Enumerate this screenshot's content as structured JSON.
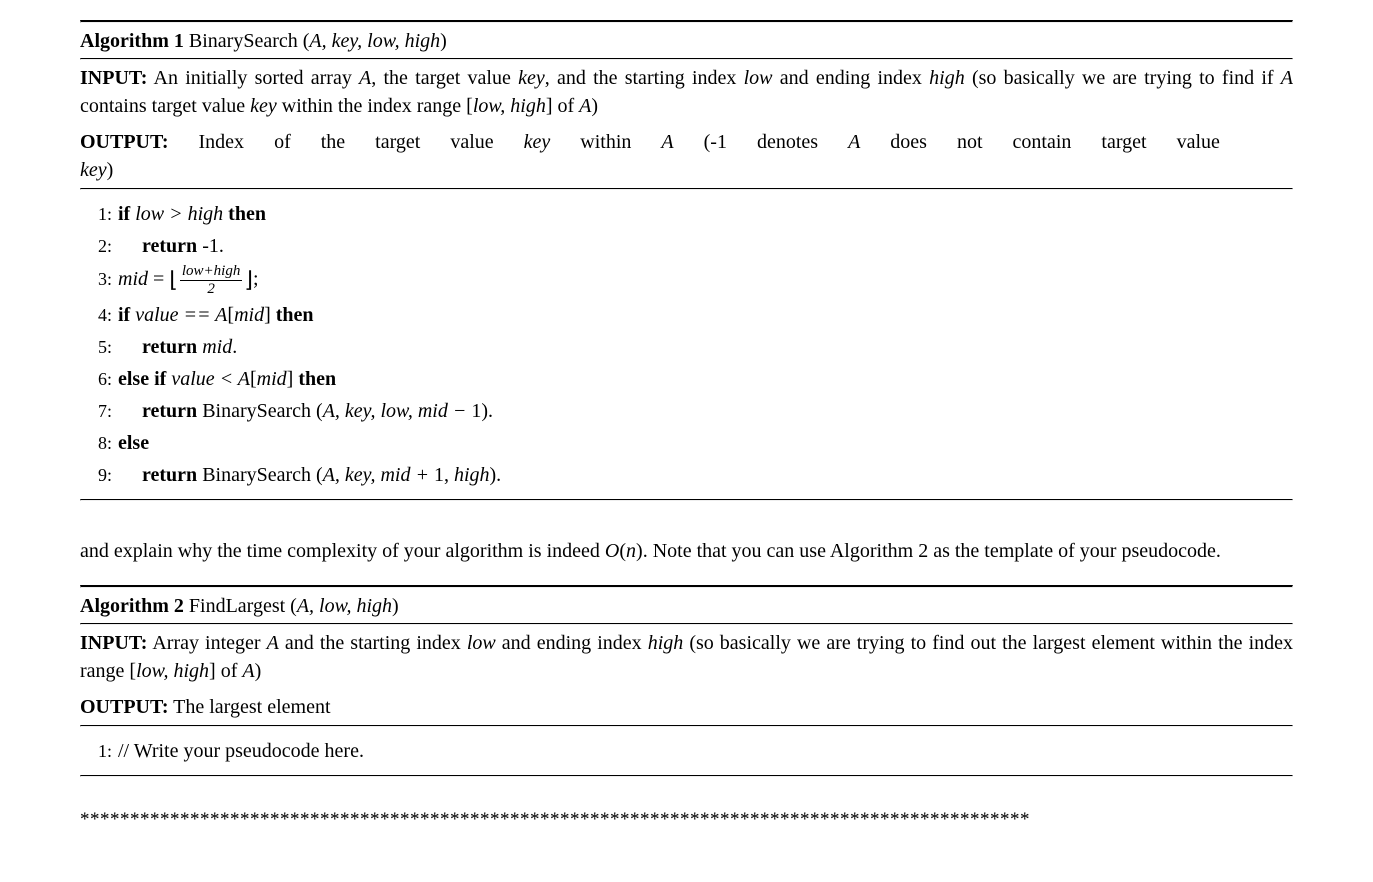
{
  "algorithm1": {
    "heading_prefix": "Algorithm 1",
    "heading_name": " BinarySearch (",
    "heading_args": "A, key, low, high",
    "heading_close": ")",
    "input_label": "INPUT:",
    "input_text_1": " An initially sorted array ",
    "input_var_A": "A",
    "input_text_2": ", the target value ",
    "input_var_key": "key",
    "input_text_3": ", and the starting index ",
    "input_var_low": "low",
    "input_text_4": " and ending index ",
    "input_var_high": "high",
    "input_text_5": " (so basically we are trying to find if ",
    "input_var_A2": "A",
    "input_text_6": " contains target value ",
    "input_var_key2": "key",
    "input_text_7": " within the index range [",
    "input_var_lowhigh": "low, high",
    "input_text_8": "] of ",
    "input_var_A3": "A",
    "input_text_9": ")",
    "output_label": "OUTPUT:",
    "output_w1": "Index",
    "output_w2": "of",
    "output_w3": "the",
    "output_w4": "target",
    "output_w5": "value",
    "output_var_key": "key",
    "output_w6": "within",
    "output_var_A": "A",
    "output_w7": "(-1",
    "output_w8": "denotes",
    "output_var_A2": "A",
    "output_w9": "does",
    "output_w10": "not",
    "output_w11": "contain",
    "output_w12": "target",
    "output_w13": "value",
    "output_var_key2": "key",
    "output_close": ")",
    "step1_num": "1:",
    "step1_kw_if": "if",
    "step1_cond": " low > high ",
    "step1_kw_then": "then",
    "step2_num": "2:",
    "step2_kw_return": "return",
    "step2_val": "  -1.",
    "step3_num": "3:",
    "step3_var": "mid",
    "step3_eq": " = ",
    "step3_frac_num": "low+high",
    "step3_frac_den": "2",
    "step3_end": ";",
    "step4_num": "4:",
    "step4_kw_if": "if",
    "step4_cond1": " value == A",
    "step4_cond2": "[",
    "step4_cond3": "mid",
    "step4_cond4": "] ",
    "step4_kw_then": "then",
    "step5_num": "5:",
    "step5_kw_return": "return",
    "step5_val": "  mid",
    "step5_end": ".",
    "step6_num": "6:",
    "step6_kw_elseif": "else if",
    "step6_cond1": " value < A",
    "step6_cond2": "[",
    "step6_cond3": "mid",
    "step6_cond4": "] ",
    "step6_kw_then": "then",
    "step7_num": "7:",
    "step7_kw_return": "return",
    "step7_text": "  BinarySearch (",
    "step7_args": "A, key, low, mid − ",
    "step7_one": "1).",
    "step8_num": "8:",
    "step8_kw_else": "else",
    "step9_num": "9:",
    "step9_kw_return": "return",
    "step9_text": "  BinarySearch (",
    "step9_args": "A, key, mid + ",
    "step9_one": "1, ",
    "step9_high": "high",
    "step9_close": ")."
  },
  "middle": {
    "text1": "and explain why the time complexity of your algorithm is indeed ",
    "bigO": "O",
    "paren1": "(",
    "n": "n",
    "paren2": ")",
    "text2": ". Note that you can use Algorithm 2 as the template of your pseudocode."
  },
  "algorithm2": {
    "heading_prefix": "Algorithm 2",
    "heading_name": " FindLargest (",
    "heading_args": "A, low, high",
    "heading_close": ")",
    "input_label": "INPUT:",
    "input_text_1": " Array integer ",
    "input_var_A": "A",
    "input_text_2": " and the starting index ",
    "input_var_low": "low",
    "input_text_3": " and ending index ",
    "input_var_high": "high",
    "input_text_4": " (so basically we are trying to find out the largest element within the index range [",
    "input_var_lowhigh": "low, high",
    "input_text_5": "] of ",
    "input_var_A2": "A",
    "input_text_6": ")",
    "output_label": "OUTPUT:",
    "output_text": " The largest element",
    "step1_num": "1:",
    "step1_text": "// Write your pseudocode here."
  },
  "asterisks": "***********************************************************************************************"
}
